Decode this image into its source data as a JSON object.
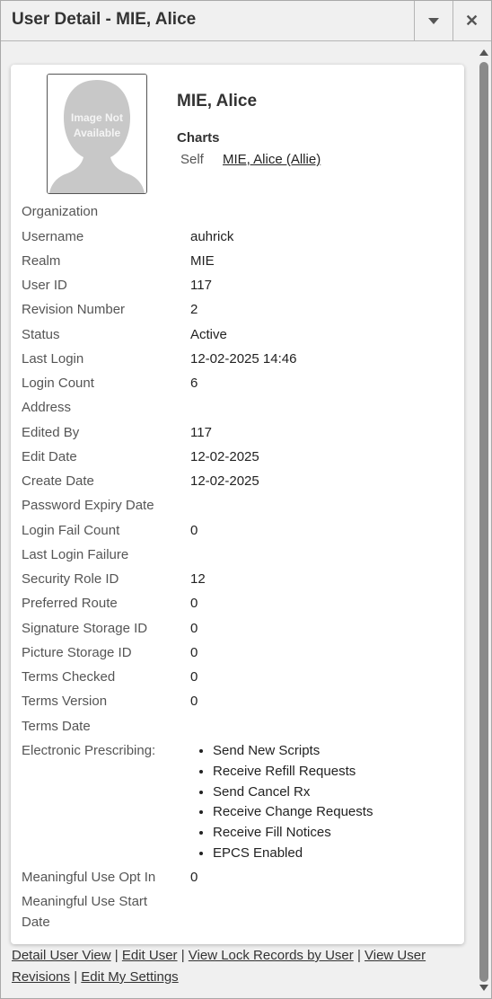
{
  "window": {
    "title": "User Detail - MIE, Alice",
    "close_glyph": "✕"
  },
  "photo": {
    "line1": "Image Not",
    "line2": "Available"
  },
  "user": {
    "name": "MIE, Alice"
  },
  "charts": {
    "label": "Charts",
    "relation": "Self",
    "link": "MIE, Alice (Allie)"
  },
  "fields": [
    {
      "label": "Organization",
      "value": ""
    },
    {
      "label": "Username",
      "value": "auhrick"
    },
    {
      "label": "Realm",
      "value": "MIE"
    },
    {
      "label": "User ID",
      "value": "117"
    },
    {
      "label": "Revision Number",
      "value": "2"
    },
    {
      "label": "Status",
      "value": "Active"
    },
    {
      "label": "Last Login",
      "value": "12-02-2025 14:46"
    },
    {
      "label": "Login Count",
      "value": "6"
    },
    {
      "label": "Address",
      "value": ""
    },
    {
      "label": "Edited By",
      "value": "117"
    },
    {
      "label": "Edit Date",
      "value": "12-02-2025"
    },
    {
      "label": "Create Date",
      "value": "12-02-2025"
    },
    {
      "label": "Password Expiry Date",
      "value": ""
    },
    {
      "label": "Login Fail Count",
      "value": "0"
    },
    {
      "label": "Last Login Failure",
      "value": ""
    },
    {
      "label": "Security Role ID",
      "value": "12"
    },
    {
      "label": "Preferred Route",
      "value": "0"
    },
    {
      "label": "Signature Storage ID",
      "value": "0"
    },
    {
      "label": "Picture Storage ID",
      "value": "0"
    },
    {
      "label": "Terms Checked",
      "value": "0"
    },
    {
      "label": "Terms Version",
      "value": "0"
    },
    {
      "label": "Terms Date",
      "value": ""
    },
    {
      "label": "Electronic Prescribing:",
      "value": ""
    },
    {
      "label": "Meaningful Use Opt In",
      "value": "0"
    },
    {
      "label": "Meaningful Use Start",
      "value": ""
    },
    {
      "label": "Date",
      "value": ""
    }
  ],
  "erx": [
    "Send New Scripts",
    "Receive Refill Requests",
    "Send Cancel Rx",
    "Receive Change Requests",
    "Receive Fill Notices",
    "EPCS Enabled"
  ],
  "footer": {
    "links": [
      "Detail User View",
      "Edit User",
      "View Lock Records by User",
      "View User Revisions",
      "Edit My Settings"
    ],
    "separator": "|"
  },
  "icons": {
    "minimize": "chevron-down-icon",
    "close": "close-icon"
  }
}
